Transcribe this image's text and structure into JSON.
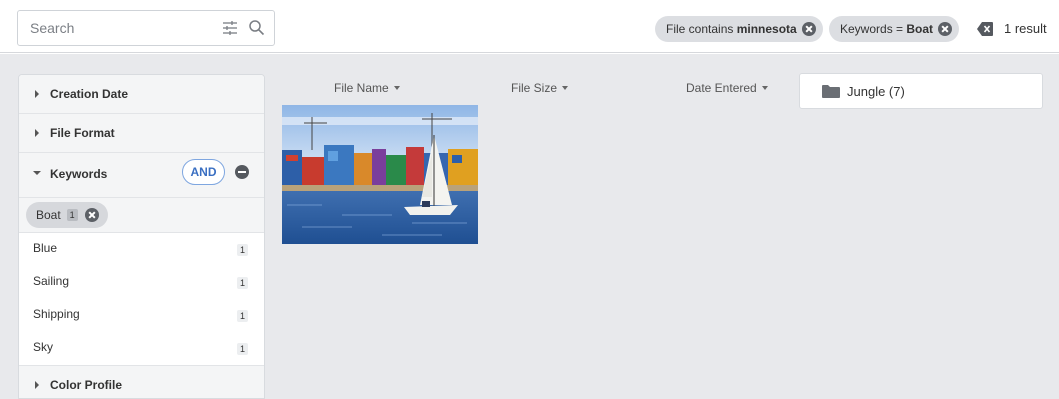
{
  "search": {
    "placeholder": "Search",
    "filters_icon": "sliders-icon",
    "search_icon": "magnifier-icon"
  },
  "active_filters": [
    {
      "prefix": "File contains ",
      "value": "minnesota"
    },
    {
      "prefix": "Keywords = ",
      "value": "Boat"
    }
  ],
  "clear_all_icon": "backspace-icon",
  "result_count": "1 result",
  "sidebar": {
    "facets": {
      "creation_date": "Creation Date",
      "file_format": "File Format",
      "keywords": "Keywords",
      "color_profile": "Color Profile"
    },
    "keywords_operator": "AND",
    "selected_keyword": {
      "label": "Boat",
      "count": "1"
    },
    "keyword_options": [
      {
        "label": "Blue",
        "count": "1"
      },
      {
        "label": "Sailing",
        "count": "1"
      },
      {
        "label": "Shipping",
        "count": "1"
      },
      {
        "label": "Sky",
        "count": "1"
      }
    ]
  },
  "columns": {
    "file_name": "File Name",
    "file_size": "File Size",
    "date_entered": "Date Entered"
  },
  "folder": {
    "label": "Jungle (7)",
    "icon": "folder-icon"
  },
  "colors": {
    "accent": "#3a6fc2",
    "chip_bg": "#dcdee2",
    "panel_bg": "#e8e9ec"
  }
}
